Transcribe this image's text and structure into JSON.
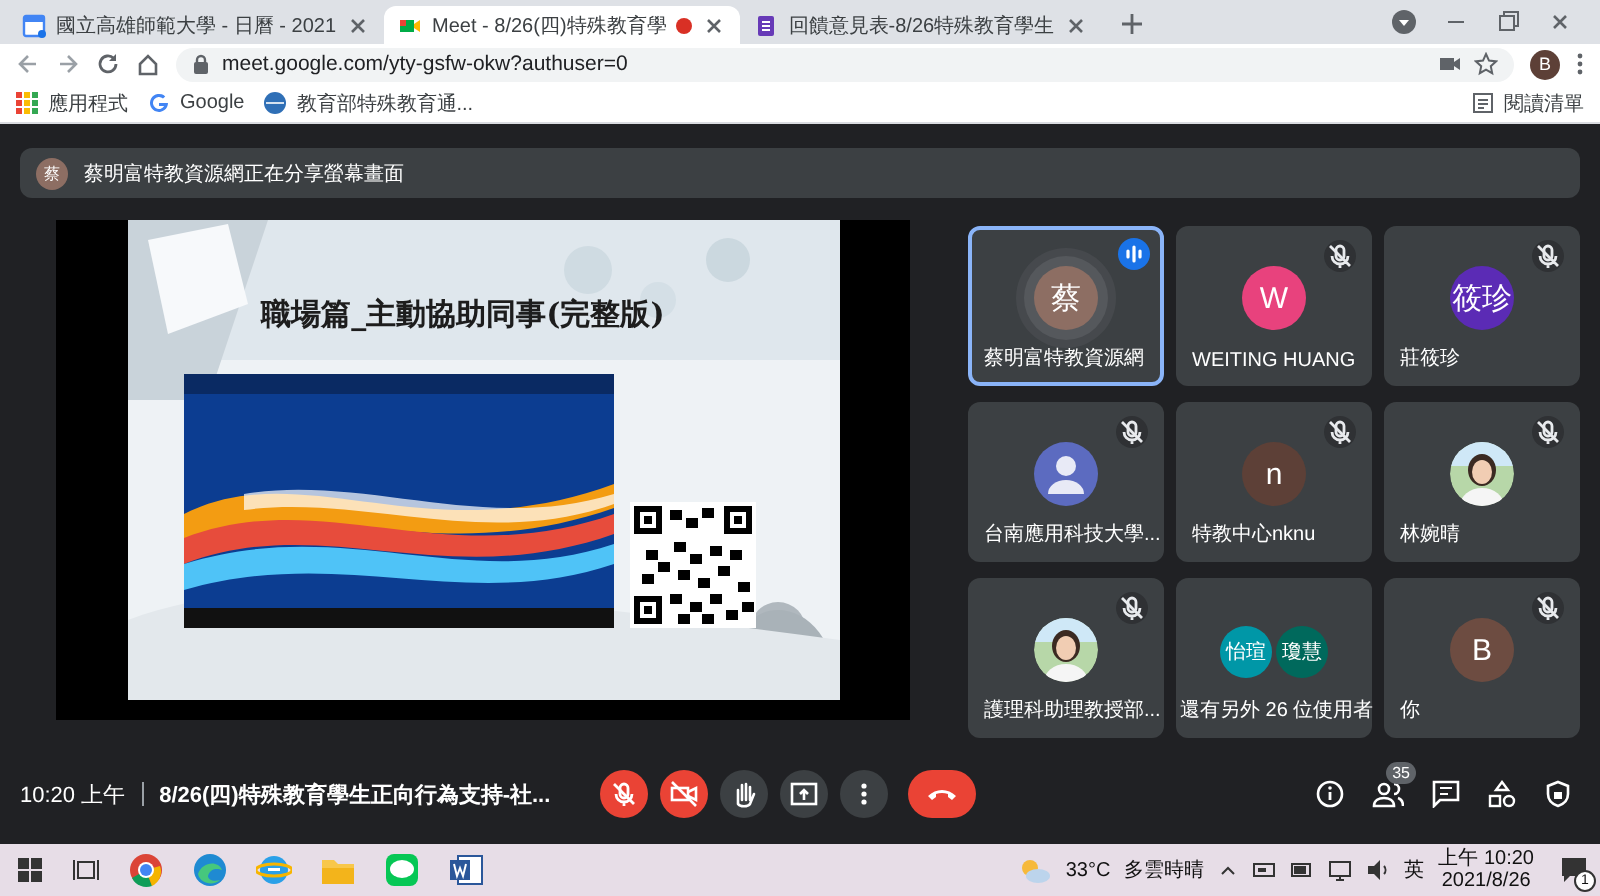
{
  "browser": {
    "tabs": [
      {
        "title": "國立高雄師範大學 - 日曆 - 2021",
        "kind": "calendar",
        "selected": false,
        "recording": false
      },
      {
        "title": "Meet - 8/26(四)特殊教育學",
        "kind": "meet",
        "selected": true,
        "recording": true
      },
      {
        "title": "回饋意見表-8/26特殊教育學生",
        "kind": "form",
        "selected": false,
        "recording": false
      }
    ],
    "address": "meet.google.com/yty-gsfw-okw?authuser=0",
    "profile": "B",
    "bookmarks": [
      {
        "label": "應用程式",
        "kind": "apps"
      },
      {
        "label": "Google",
        "kind": "google"
      },
      {
        "label": "教育部特殊教育通...",
        "kind": "site"
      }
    ],
    "reading_list": "閱讀清單"
  },
  "presenting_banner": {
    "avatar": "蔡",
    "text": "蔡明富特教資源網正在分享螢幕畫面"
  },
  "shared_screen": {
    "slide_title": "職場篇_主動協助同事(完整版)"
  },
  "participants": [
    {
      "name": "蔡明富特教資源網",
      "kind": "letter",
      "avatar": "蔡",
      "color": "#8d6e63",
      "muted": false,
      "speaking": true
    },
    {
      "name": "WEITING HUANG",
      "kind": "letter",
      "avatar": "W",
      "color": "#e8427d",
      "muted": true,
      "speaking": false
    },
    {
      "name": "莊筱珍",
      "kind": "letter",
      "avatar": "筱珍",
      "color": "#5b2bb5",
      "muted": true,
      "speaking": false
    },
    {
      "name": "台南應用科技大學...",
      "kind": "generic",
      "color": "#5c6bc0",
      "muted": true,
      "speaking": false
    },
    {
      "name": "特教中心nknu",
      "kind": "letter",
      "avatar": "n",
      "color": "#5d4037",
      "muted": true,
      "speaking": false
    },
    {
      "name": "林婉晴",
      "muted": true,
      "speaking": false
    },
    {
      "name": "護理科助理教授部...",
      "muted": true,
      "speaking": false
    },
    {
      "name": "還有另外 26 位使用者",
      "kind": "group",
      "avatars": [
        {
          "initials": "怡瑄",
          "color": "#0097a7"
        },
        {
          "initials": "瓊慧",
          "color": "#00695c"
        }
      ],
      "muted": false,
      "speaking": false
    },
    {
      "name": "你",
      "kind": "letter",
      "avatar": "B",
      "color": "#6d4c41",
      "muted": true,
      "speaking": false
    }
  ],
  "bottom_bar": {
    "time": "10:20 上午",
    "meeting_title": "8/26(四)特殊教育學生正向行為支持-社...",
    "mic_on": false,
    "camera_on": false,
    "participant_count": "35"
  },
  "taskbar": {
    "temperature": "33°C",
    "weather": "多雲時晴",
    "input_method": "英",
    "time": "上午 10:20",
    "date": "2021/8/26",
    "notifications": "1"
  }
}
